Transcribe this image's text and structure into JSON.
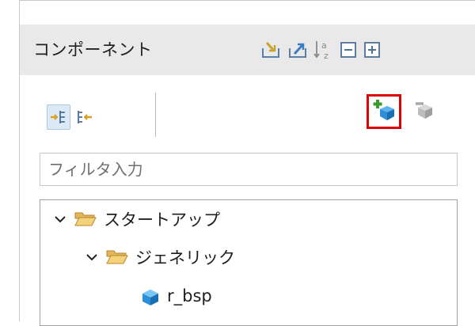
{
  "panel": {
    "title": "コンポーネント"
  },
  "header_icons": [
    "import-icon",
    "export-icon",
    "sort-az-icon",
    "collapse-all-icon",
    "expand-all-icon"
  ],
  "view_toolbar": {
    "icons": [
      "tree-view-icon",
      "hierarchy-view-icon"
    ],
    "add_icon": "add-component-icon",
    "remove_icon": "remove-component-icon",
    "highlight_color": "#e10000"
  },
  "filter": {
    "placeholder": "フィルタ入力",
    "value": ""
  },
  "tree": {
    "items": [
      {
        "label": "スタートアップ",
        "type": "folder",
        "expanded": true
      },
      {
        "label": "ジェネリック",
        "type": "folder",
        "expanded": true
      },
      {
        "label": "r_bsp",
        "type": "component"
      }
    ]
  }
}
